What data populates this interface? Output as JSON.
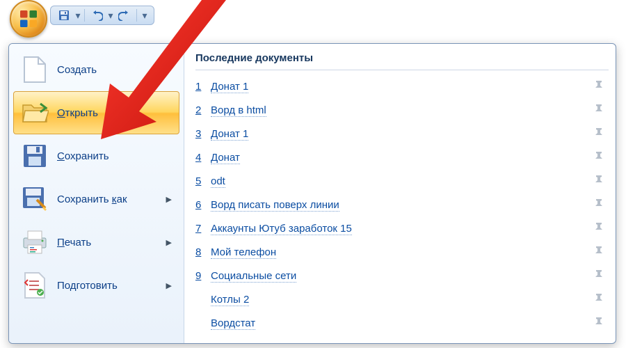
{
  "qat": {
    "save": "save",
    "undo": "undo",
    "redo": "redo"
  },
  "menu": {
    "items": [
      {
        "label": "Создать",
        "underline": "",
        "hasArrow": false
      },
      {
        "label": "Открыть",
        "underline": "О",
        "hasArrow": false
      },
      {
        "label": "Сохранить",
        "underline": "С",
        "hasArrow": false
      },
      {
        "label": "Сохранить как",
        "underline": "к",
        "hasArrow": true
      },
      {
        "label": "Печать",
        "underline": "П",
        "hasArrow": true
      },
      {
        "label": "Подготовить",
        "underline": "д",
        "hasArrow": true
      }
    ]
  },
  "recent": {
    "title": "Последние документы",
    "docs": [
      {
        "n": "1",
        "name": "Донат 1"
      },
      {
        "n": "2",
        "name": "Ворд в html"
      },
      {
        "n": "3",
        "name": "Донат 1"
      },
      {
        "n": "4",
        "name": "Донат"
      },
      {
        "n": "5",
        "name": "odt"
      },
      {
        "n": "6",
        "name": "Ворд писать поверх линии"
      },
      {
        "n": "7",
        "name": "Аккаунты Ютуб заработок 15"
      },
      {
        "n": "8",
        "name": "Мой телефон"
      },
      {
        "n": "9",
        "name": "Социальные сети"
      },
      {
        "n": "",
        "name": "Котлы 2"
      },
      {
        "n": "",
        "name": "Вордстат"
      }
    ]
  }
}
